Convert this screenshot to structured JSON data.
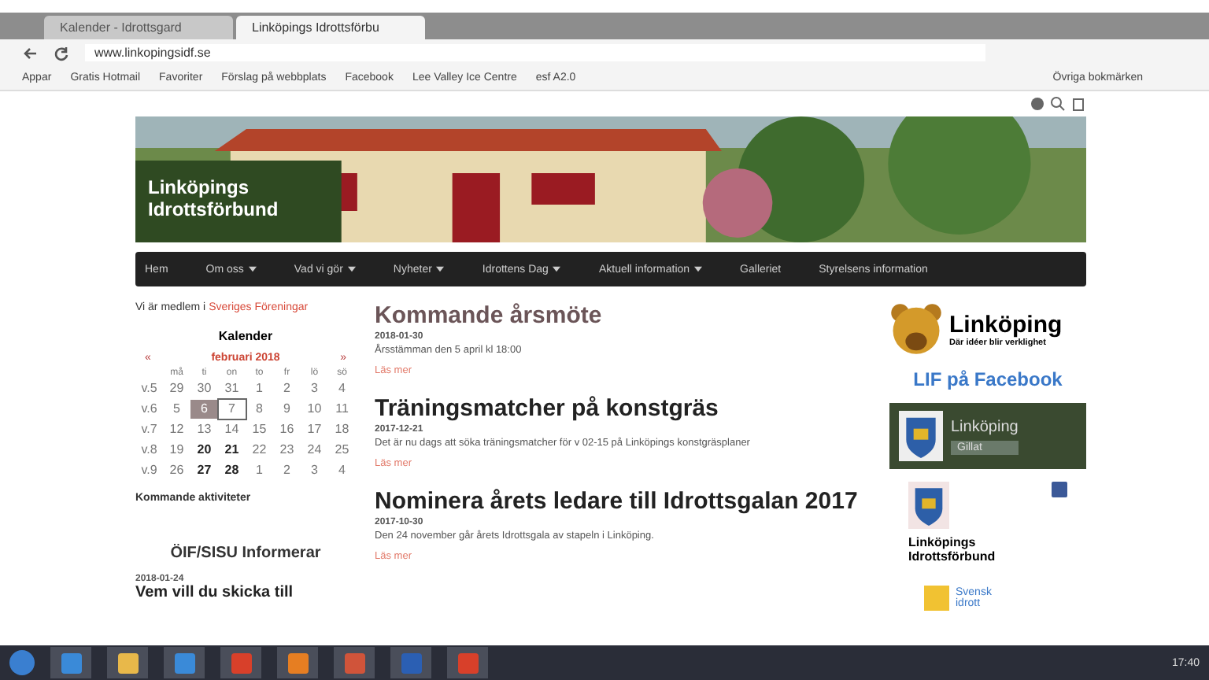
{
  "browser": {
    "tabs": [
      {
        "label": "Kalender - Idrottsgard",
        "selected": false
      },
      {
        "label": "Linköpings Idrottsförbu",
        "selected": true
      }
    ],
    "address": "www.linkopingsidf.se",
    "bookmarks": [
      "Appar",
      "Gratis Hotmail",
      "Favoriter",
      "Förslag på webbplats",
      "Facebook",
      "Lee Valley Ice Centre",
      "esf A2.0"
    ],
    "other_bookmarks": "Övriga bokmärken"
  },
  "site": {
    "title": "Linköpings Idrottsförbund",
    "nav": [
      {
        "label": "Hem",
        "dropdown": false
      },
      {
        "label": "Om oss",
        "dropdown": true
      },
      {
        "label": "Vad vi gör",
        "dropdown": true
      },
      {
        "label": "Nyheter",
        "dropdown": true
      },
      {
        "label": "Idrottens Dag",
        "dropdown": true
      },
      {
        "label": "Aktuell information",
        "dropdown": true
      },
      {
        "label": "Galleriet",
        "dropdown": false
      },
      {
        "label": "Styrelsens information",
        "dropdown": false
      }
    ],
    "member": {
      "text": "Vi är medlem i",
      "link": "Sveriges Föreningar"
    },
    "calendar": {
      "heading": "Kalender",
      "prev": "«",
      "month": "februari 2018",
      "next": "»",
      "weekdays": [
        "må",
        "ti",
        "on",
        "to",
        "fr",
        "lö",
        "sö"
      ],
      "weeks": [
        {
          "week": "v.5",
          "days": [
            {
              "d": "29",
              "selected": false,
              "today": false,
              "events": false
            },
            {
              "d": "30",
              "selected": false,
              "today": false,
              "events": false
            },
            {
              "d": "31",
              "selected": false,
              "today": false,
              "events": false
            },
            {
              "d": "1",
              "selected": false,
              "today": false,
              "events": false
            },
            {
              "d": "2",
              "selected": false,
              "today": false,
              "events": false
            },
            {
              "d": "3",
              "selected": false,
              "today": false,
              "events": false
            },
            {
              "d": "4",
              "selected": false,
              "today": false,
              "events": false
            }
          ]
        },
        {
          "week": "v.6",
          "days": [
            {
              "d": "5",
              "selected": false,
              "today": false,
              "events": false
            },
            {
              "d": "6",
              "selected": true,
              "today": false,
              "events": false
            },
            {
              "d": "7",
              "selected": false,
              "today": true,
              "events": false
            },
            {
              "d": "8",
              "selected": false,
              "today": false,
              "events": false
            },
            {
              "d": "9",
              "selected": false,
              "today": false,
              "events": false
            },
            {
              "d": "10",
              "selected": false,
              "today": false,
              "events": false
            },
            {
              "d": "11",
              "selected": false,
              "today": false,
              "events": false
            }
          ]
        },
        {
          "week": "v.7",
          "days": [
            {
              "d": "12",
              "selected": false,
              "today": false,
              "events": false
            },
            {
              "d": "13",
              "selected": false,
              "today": false,
              "events": false
            },
            {
              "d": "14",
              "selected": false,
              "today": false,
              "events": false
            },
            {
              "d": "15",
              "selected": false,
              "today": false,
              "events": false
            },
            {
              "d": "16",
              "selected": false,
              "today": false,
              "events": false
            },
            {
              "d": "17",
              "selected": false,
              "today": false,
              "events": false
            },
            {
              "d": "18",
              "selected": false,
              "today": false,
              "events": false
            }
          ]
        },
        {
          "week": "v.8",
          "days": [
            {
              "d": "19",
              "selected": false,
              "today": false,
              "events": false
            },
            {
              "d": "20",
              "selected": false,
              "today": false,
              "events": true
            },
            {
              "d": "21",
              "selected": false,
              "today": false,
              "events": true
            },
            {
              "d": "22",
              "selected": false,
              "today": false,
              "events": false
            },
            {
              "d": "23",
              "selected": false,
              "today": false,
              "events": false
            },
            {
              "d": "24",
              "selected": false,
              "today": false,
              "events": false
            },
            {
              "d": "25",
              "selected": false,
              "today": false,
              "events": false
            }
          ]
        },
        {
          "week": "v.9",
          "days": [
            {
              "d": "26",
              "selected": false,
              "today": false,
              "events": false
            },
            {
              "d": "27",
              "selected": false,
              "today": false,
              "events": true
            },
            {
              "d": "28",
              "selected": false,
              "today": false,
              "events": true
            },
            {
              "d": "1",
              "selected": false,
              "today": false,
              "events": false
            },
            {
              "d": "2",
              "selected": false,
              "today": false,
              "events": false
            },
            {
              "d": "3",
              "selected": false,
              "today": false,
              "events": false
            },
            {
              "d": "4",
              "selected": false,
              "today": false,
              "events": false
            }
          ]
        }
      ],
      "upcoming": "Kommande aktiviteter"
    },
    "info": {
      "heading": "ÖIF/SISU Informerar",
      "date": "2018-01-24",
      "title": "Vem vill du skicka till"
    },
    "posts": [
      {
        "title": "Kommande årsmöte",
        "date": "2018-01-30",
        "text": "Årsstämman den 5 april kl 18:00",
        "more": "Läs mer"
      },
      {
        "title": "Träningsmatcher på konstgräs",
        "date": "2017-12-21",
        "text": "Det är nu dags att söka träningsmatcher för v 02-15 på Linköpings konstgräsplaner",
        "more": "Läs mer"
      },
      {
        "title": "Nominera årets ledare till Idrottsgalan 2017",
        "date": "2017-10-30",
        "text": "Den 24 november går årets Idrottsgala av stapeln i Linköping.",
        "more": "Läs mer"
      }
    ],
    "aside": {
      "logo": "Linköping",
      "tagline": "Där idéer blir verklighet",
      "facebook_heading": "LIF på Facebook",
      "fb_page": "Linköping",
      "fb_button": "Gillat",
      "fb_name": "Linköpings Idrottsförbund",
      "sponsor": "Svensk idrott"
    }
  },
  "taskbar": {
    "time": "17:40"
  }
}
